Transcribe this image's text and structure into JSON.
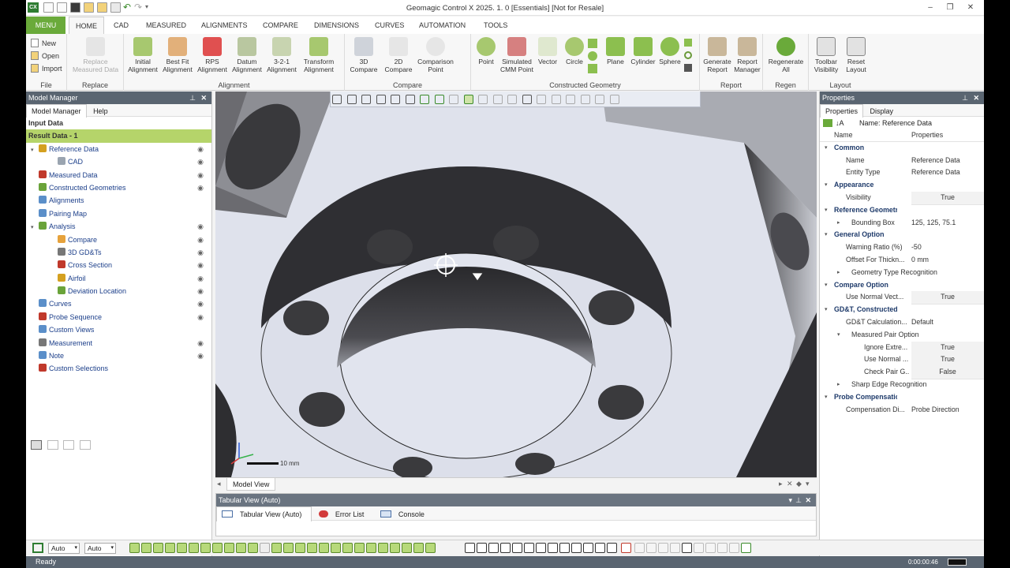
{
  "window": {
    "title": "Geomagic Control X 2025. 1. 0 [Essentials] [Not for Resale]",
    "app_icon": "CX"
  },
  "ribbon_tabs": [
    "MENU",
    "HOME",
    "CAD",
    "MEASURED",
    "ALIGNMENTS",
    "COMPARE",
    "DIMENSIONS",
    "CURVES",
    "AUTOMATION",
    "TOOLS"
  ],
  "file_group": {
    "label": "File",
    "new": "New",
    "open": "Open",
    "import": "Import"
  },
  "replace_group": {
    "label": "Replace",
    "button": "Replace Measured Data"
  },
  "alignment_group": {
    "label": "Alignment",
    "buttons": [
      "Initial Alignment",
      "Best Fit Alignment",
      "RPS Alignment",
      "Datum Alignment",
      "3-2-1 Alignment",
      "Transform Alignment"
    ]
  },
  "compare_group": {
    "label": "Compare",
    "buttons": [
      "3D Compare",
      "2D Compare",
      "Comparison Point"
    ]
  },
  "constructed_group": {
    "label": "Constructed Geometry",
    "buttons": [
      "Point",
      "Simulated CMM Point",
      "Vector",
      "Circle",
      "Plane",
      "Cylinder",
      "Sphere"
    ]
  },
  "report_group": {
    "label": "Report",
    "buttons": [
      "Generate Report",
      "Report Manager"
    ]
  },
  "regen_group": {
    "label": "Regen",
    "buttons": [
      "Regenerate All"
    ]
  },
  "layout_group": {
    "label": "Layout",
    "buttons": [
      "Toolbar Visibility",
      "Reset Layout"
    ]
  },
  "model_manager": {
    "title": "Model Manager",
    "tabs": [
      "Model Manager",
      "Help"
    ],
    "input_data": "Input Data",
    "result_data": "Result Data - 1",
    "items": [
      {
        "label": "Reference Data",
        "level": 1,
        "eye": true,
        "color": "#d4a020"
      },
      {
        "label": "CAD",
        "level": 2,
        "eye": true,
        "color": "#9aa4b0"
      },
      {
        "label": "Measured Data",
        "level": 1,
        "eye": true,
        "color": "#c0392b"
      },
      {
        "label": "Constructed Geometries",
        "level": 1,
        "eye": true,
        "color": "#6aa33a"
      },
      {
        "label": "Alignments",
        "level": 1,
        "eye": false,
        "color": "#5b8fc9"
      },
      {
        "label": "Pairing Map",
        "level": 1,
        "eye": false,
        "color": "#5b8fc9"
      },
      {
        "label": "Analysis",
        "level": 1,
        "eye": true,
        "color": "#6aa33a"
      },
      {
        "label": "Compare",
        "level": 2,
        "eye": true,
        "color": "#e6a23c"
      },
      {
        "label": "3D GD&Ts",
        "level": 2,
        "eye": true,
        "color": "#777"
      },
      {
        "label": "Cross Section",
        "level": 2,
        "eye": true,
        "color": "#c0392b"
      },
      {
        "label": "Airfoil",
        "level": 2,
        "eye": true,
        "color": "#d4a020"
      },
      {
        "label": "Deviation Location",
        "level": 2,
        "eye": true,
        "color": "#6aa33a"
      },
      {
        "label": "Curves",
        "level": 1,
        "eye": true,
        "color": "#5b8fc9"
      },
      {
        "label": "Probe Sequence",
        "level": 1,
        "eye": true,
        "color": "#c0392b"
      },
      {
        "label": "Custom Views",
        "level": 1,
        "eye": false,
        "color": "#5b8fc9"
      },
      {
        "label": "Measurement",
        "level": 1,
        "eye": true,
        "color": "#777"
      },
      {
        "label": "Note",
        "level": 1,
        "eye": true,
        "color": "#5b8fc9"
      },
      {
        "label": "Custom Selections",
        "level": 1,
        "eye": false,
        "color": "#c0392b"
      }
    ]
  },
  "viewport": {
    "scale_label": "10 mm",
    "tab": "Model View"
  },
  "tabular": {
    "title": "Tabular View (Auto)",
    "tabs": [
      "Tabular View (Auto)",
      "Error List",
      "Console"
    ]
  },
  "properties": {
    "title": "Properties",
    "tabs": [
      "Properties",
      "Display"
    ],
    "name_label": "Name: Reference Data",
    "col_name": "Name",
    "col_props": "Properties",
    "rows": [
      {
        "type": "sec",
        "k": "Common"
      },
      {
        "type": "row",
        "k": "Name",
        "v": "Reference Data"
      },
      {
        "type": "row",
        "k": "Entity Type",
        "v": "Reference Data"
      },
      {
        "type": "sec",
        "k": "Appearance"
      },
      {
        "type": "row",
        "k": "Visibility",
        "v": "True",
        "box": true
      },
      {
        "type": "sec",
        "k": "Reference Geometry"
      },
      {
        "type": "exp",
        "k": "Bounding Box",
        "v": "125, 125, 75.1"
      },
      {
        "type": "sec",
        "k": "General Option"
      },
      {
        "type": "row",
        "k": "Warning Ratio (%)",
        "v": "-50"
      },
      {
        "type": "row",
        "k": "Offset For Thickn...",
        "v": "0 mm"
      },
      {
        "type": "exp",
        "k": "Geometry Type Recognition",
        "v": ""
      },
      {
        "type": "sec",
        "k": "Compare Option"
      },
      {
        "type": "row",
        "k": "Use Normal Vect...",
        "v": "True",
        "box": true
      },
      {
        "type": "sec",
        "k": "GD&T, Constructed Geom Option"
      },
      {
        "type": "row",
        "k": "GD&T Calculation...",
        "v": "Default"
      },
      {
        "type": "open",
        "k": "Measured Pair Option",
        "v": ""
      },
      {
        "type": "sub2",
        "k": "Ignore Extre...",
        "v": "True",
        "box": true
      },
      {
        "type": "sub2",
        "k": "Use Normal ...",
        "v": "True",
        "box": true
      },
      {
        "type": "sub2",
        "k": "Check Pair G...",
        "v": "False",
        "box": true
      },
      {
        "type": "exp",
        "k": "Sharp Edge Recognition",
        "v": ""
      },
      {
        "type": "sec",
        "k": "Probe Compensation"
      },
      {
        "type": "row",
        "k": "Compensation Di...",
        "v": "Probe Direction"
      }
    ]
  },
  "bottom_toolbar": {
    "select1": "Auto",
    "select2": "Auto"
  },
  "status": {
    "text": "Ready",
    "timer": "0:00:00:46"
  }
}
